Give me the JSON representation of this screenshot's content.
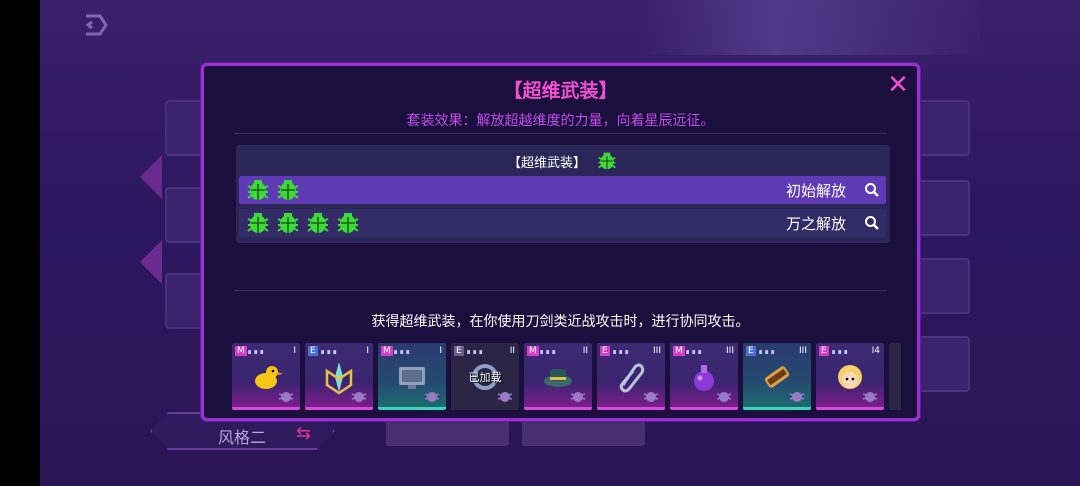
{
  "background": {
    "style_label": "风格二"
  },
  "dialog": {
    "title": "【超维武装】",
    "set_effect": "套装效果：解放超越维度的力量，向着星辰远征。",
    "set_header_name": "【超维武装】",
    "tiers": [
      {
        "label": "初始解放",
        "icon_count": 2,
        "selected": true
      },
      {
        "label": "万之解放",
        "icon_count": 4,
        "selected": false
      }
    ],
    "description": "获得超维武装，在你使用刀剑类近战攻击时，进行协同攻击。",
    "cards": [
      {
        "badge": "M",
        "badge_type": "m",
        "tier": "I",
        "icon": "duck-icon",
        "style": "pink"
      },
      {
        "badge": "E",
        "badge_type": "e",
        "tier": "I",
        "icon": "sword-emblem-icon",
        "style": "pink"
      },
      {
        "badge": "M",
        "badge_type": "m",
        "tier": "I",
        "icon": "computer-monitor-icon",
        "style": "teal"
      },
      {
        "badge": "E",
        "badge_type": "dim",
        "tier": "II",
        "icon": "ring-icon",
        "style": "dark",
        "overlay": "已加载"
      },
      {
        "badge": "M",
        "badge_type": "m",
        "tier": "II",
        "icon": "hat-icon",
        "style": "pink"
      },
      {
        "badge": "E",
        "badge_type": "m",
        "tier": "III",
        "icon": "paperclip-icon",
        "style": "pink"
      },
      {
        "badge": "M",
        "badge_type": "m",
        "tier": "III",
        "icon": "potion-icon",
        "style": "pink"
      },
      {
        "badge": "E",
        "badge_type": "e",
        "tier": "III",
        "icon": "scroll-icon",
        "style": "teal"
      },
      {
        "badge": "E",
        "badge_type": "m",
        "tier": "I4",
        "icon": "blonde-character-icon",
        "style": "pink"
      }
    ]
  },
  "colors": {
    "accent_magenta": "#f04fd1",
    "dialog_border": "#9a2fd6",
    "bug_green": "#3fd93a",
    "selected_row": "#5e3bb4"
  }
}
